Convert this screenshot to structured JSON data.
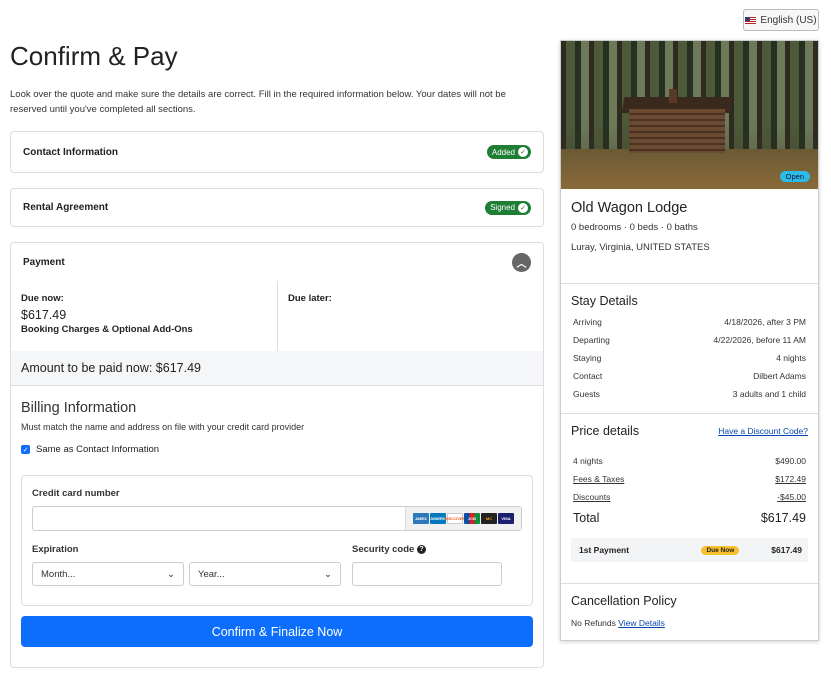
{
  "language": {
    "label": "English (US)"
  },
  "page": {
    "title": "Confirm & Pay",
    "intro": "Look over the quote and make sure the details are correct. Fill in the required information below. Your dates will not be reserved until you've completed all sections."
  },
  "sections": {
    "contact": {
      "title": "Contact Information",
      "status": "Added"
    },
    "rental": {
      "title": "Rental Agreement",
      "status": "Signed"
    },
    "payment": {
      "title": "Payment",
      "due_now_label": "Due now:",
      "due_now_amount": "$617.49",
      "due_now_desc": "Booking Charges & Optional Add-Ons",
      "due_later_label": "Due later:",
      "amount_now": "Amount to be paid now: $617.49"
    }
  },
  "billing": {
    "title": "Billing Information",
    "subtitle": "Must match the name and address on file with your credit card provider",
    "same_as_contact": "Same as Contact Information",
    "cc_label": "Credit card number",
    "cc_value": "",
    "card_brands": [
      "AMEX",
      "DINERS",
      "DISCOVER",
      "JCB",
      "MC",
      "VISA"
    ],
    "expiration_label": "Expiration",
    "month_placeholder": "Month...",
    "year_placeholder": "Year...",
    "security_label": "Security code",
    "security_value": "",
    "confirm_button": "Confirm & Finalize Now"
  },
  "property": {
    "badge": "Open",
    "name": "Old Wagon Lodge",
    "rooms": "0 bedrooms · 0 beds · 0 baths",
    "location": "Luray, Virginia, UNITED STATES"
  },
  "stay": {
    "title": "Stay Details",
    "rows": [
      {
        "label": "Arriving",
        "value": "4/18/2026, after 3 PM"
      },
      {
        "label": "Departing",
        "value": "4/22/2026, before 11 AM"
      },
      {
        "label": "Staying",
        "value": "4 nights"
      },
      {
        "label": "Contact",
        "value": "Dilbert Adams"
      },
      {
        "label": "Guests",
        "value": "3 adults and 1 child"
      }
    ]
  },
  "price": {
    "title": "Price details",
    "discount_link": "Have a Discount Code?",
    "rows": [
      {
        "label": "4 nights",
        "value": "$490.00"
      },
      {
        "label": "Fees & Taxes",
        "value": "$172.49"
      },
      {
        "label": "Discounts",
        "value": "-$45.00"
      }
    ],
    "total_label": "Total",
    "total_value": "$617.49",
    "first_payment_label": "1st Payment",
    "first_payment_badge": "Due Now",
    "first_payment_value": "$617.49"
  },
  "cancellation": {
    "title": "Cancellation Policy",
    "text": "No Refunds",
    "link": "View Details"
  },
  "colors": {
    "primary": "#0d6efd",
    "success": "#1e7e34",
    "info": "#2bbbe6",
    "warning": "#f6c12b"
  }
}
